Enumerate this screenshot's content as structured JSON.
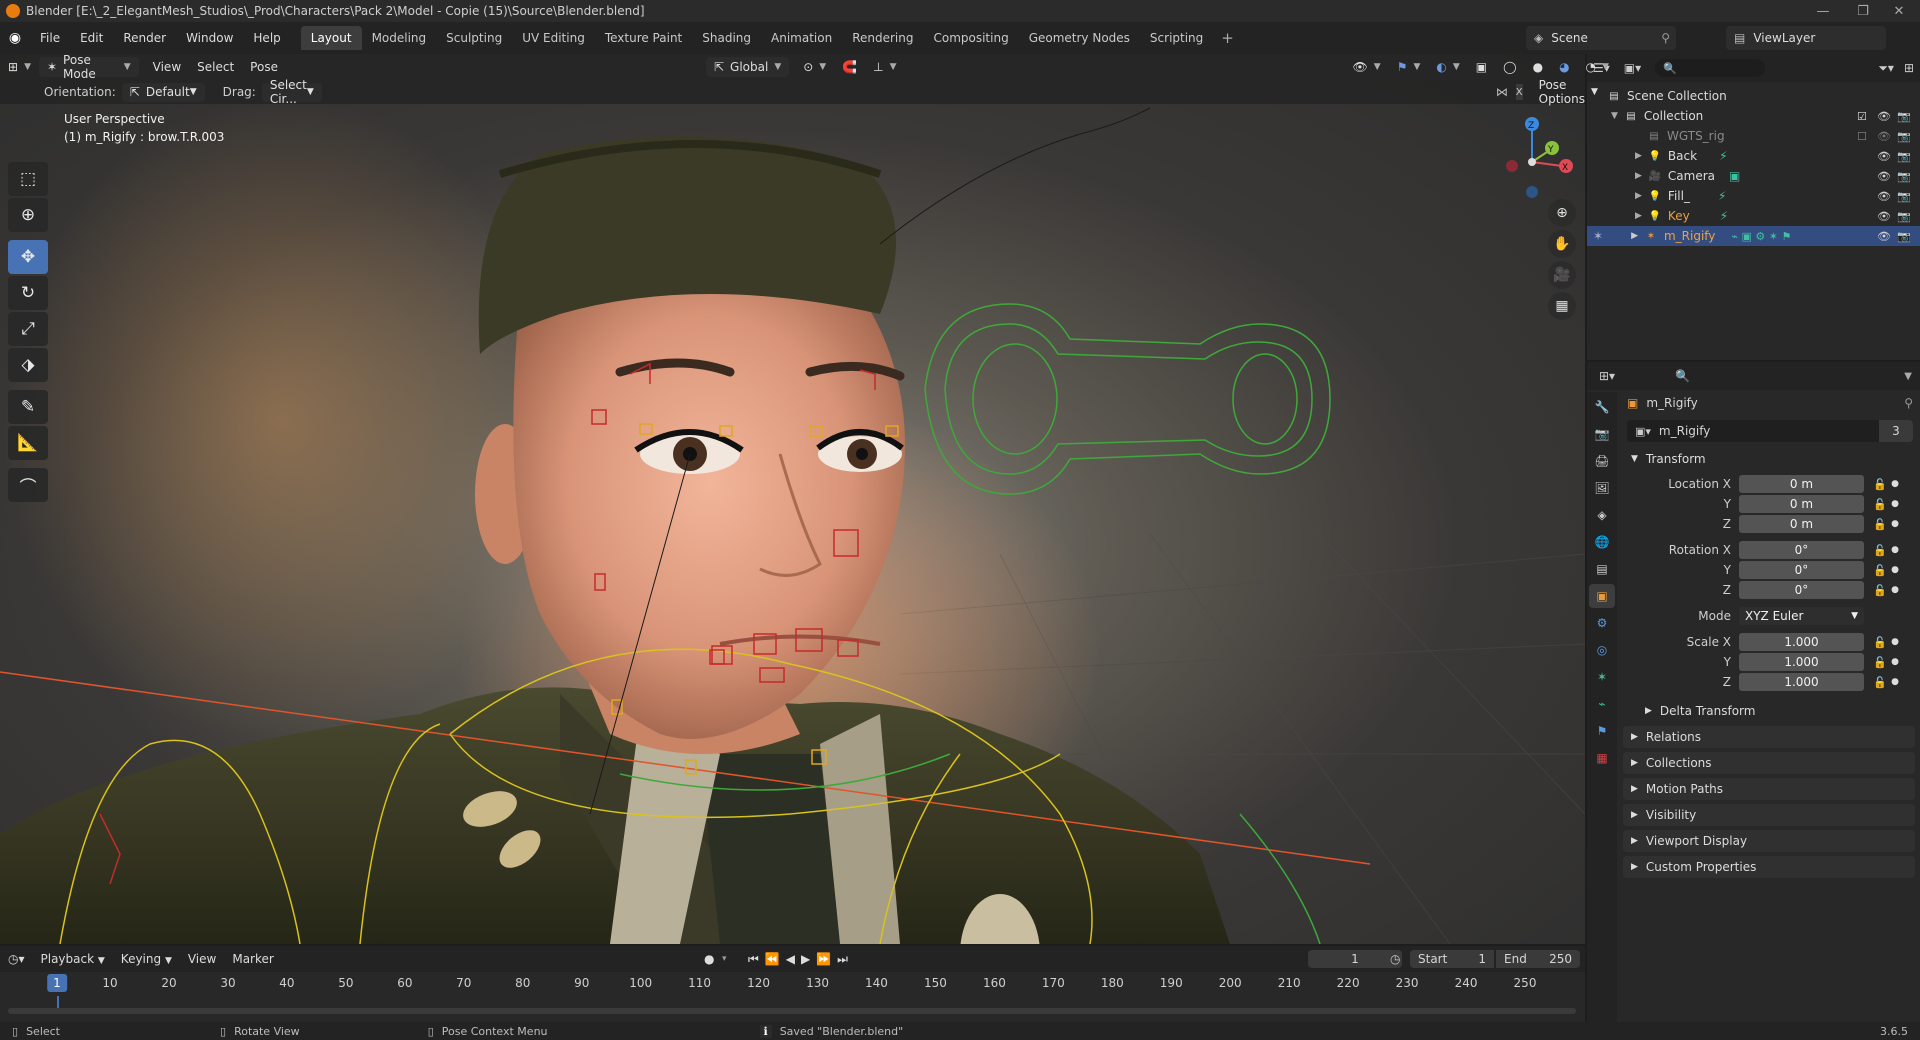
{
  "window": {
    "title": "Blender [E:\\_2_ElegantMesh_Studios\\_Prod\\Characters\\Pack 2\\Model - Copie (15)\\Source\\Blender.blend]",
    "minimize": "—",
    "maximize": "❐",
    "close": "✕"
  },
  "menubar": {
    "menus": [
      "File",
      "Edit",
      "Render",
      "Window",
      "Help"
    ],
    "workspaces": [
      "Layout",
      "Modeling",
      "Sculpting",
      "UV Editing",
      "Texture Paint",
      "Shading",
      "Animation",
      "Rendering",
      "Compositing",
      "Geometry Nodes",
      "Scripting"
    ],
    "active_workspace": 0,
    "add": "+",
    "scene": "Scene",
    "view_layer": "ViewLayer"
  },
  "viewport": {
    "mode": "Pose Mode",
    "menus": [
      "View",
      "Select",
      "Pose"
    ],
    "transform_orientation": "Global",
    "orientation_label": "Orientation:",
    "orientation_value": "Default",
    "drag_label": "Drag:",
    "drag_value": "Select Cir...",
    "pose_options": "Pose Options",
    "info_line1": "User Perspective",
    "info_line2": "(1) m_Rigify : brow.T.R.003",
    "gizmo": {
      "z": "Z",
      "y": "Y",
      "x": "X"
    }
  },
  "outliner": {
    "search_placeholder": "",
    "rows": [
      {
        "name": "Scene Collection",
        "indent": 0
      },
      {
        "name": "Collection",
        "indent": 1
      },
      {
        "name": "WGTS_rig",
        "indent": 2
      },
      {
        "name": "Back",
        "indent": 2
      },
      {
        "name": "Camera",
        "indent": 2
      },
      {
        "name": "Fill_",
        "indent": 2
      },
      {
        "name": "Key",
        "indent": 2
      },
      {
        "name": "m_Rigify",
        "indent": 2
      }
    ]
  },
  "properties": {
    "object_name": "m_Rigify",
    "data_name": "m_Rigify",
    "users": "3",
    "transform_title": "Transform",
    "location": {
      "label": "Location X",
      "x": "0 m",
      "y": "0 m",
      "z": "0 m"
    },
    "rotation": {
      "label": "Rotation X",
      "x": "0°",
      "y": "0°",
      "z": "0°"
    },
    "mode_label": "Mode",
    "mode_value": "XYZ Euler",
    "scale": {
      "label": "Scale X",
      "x": "1.000",
      "y": "1.000",
      "z": "1.000"
    },
    "axis_y": "Y",
    "axis_z": "Z",
    "delta_transform": "Delta Transform",
    "panels": [
      "Relations",
      "Collections",
      "Motion Paths",
      "Visibility",
      "Viewport Display",
      "Custom Properties"
    ]
  },
  "timeline": {
    "menus": [
      "Playback",
      "Keying",
      "View",
      "Marker"
    ],
    "current_frame": "1",
    "start_label": "Start",
    "start": "1",
    "end_label": "End",
    "end": "250",
    "ticks": [
      "10",
      "20",
      "30",
      "40",
      "50",
      "60",
      "70",
      "80",
      "90",
      "100",
      "110",
      "120",
      "130",
      "140",
      "150",
      "160",
      "170",
      "180",
      "190",
      "200",
      "210",
      "220",
      "230",
      "240",
      "250"
    ]
  },
  "statusbar": {
    "select": "Select",
    "rotate": "Rotate View",
    "context": "Pose Context Menu",
    "message": "Saved \"Blender.blend\"",
    "version": "3.6.5"
  },
  "colors": {
    "accent": "#4772b3",
    "selected_row": "#334d80",
    "bone_yellow": "#d9c21e",
    "bone_green": "#3fa83a",
    "bone_red": "#c42b2b",
    "axis_x": "#e04a55",
    "axis_y": "#8ac23a",
    "axis_z": "#3b8ae0"
  }
}
